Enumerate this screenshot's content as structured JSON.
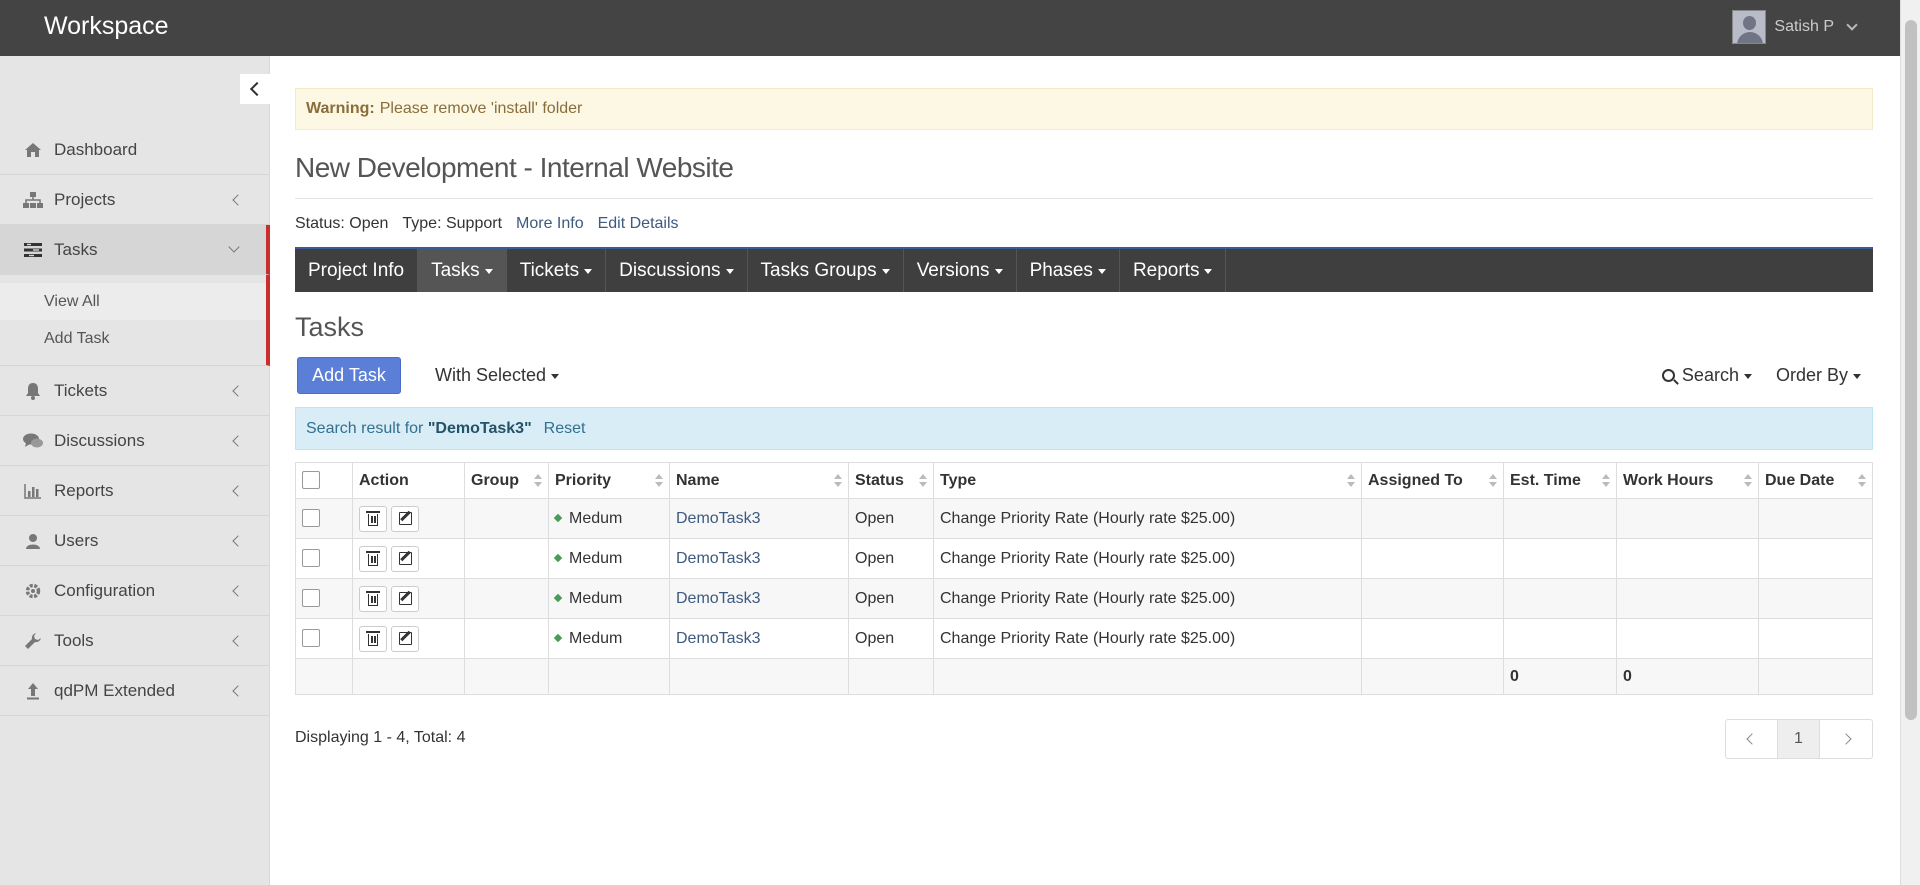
{
  "header": {
    "brand": "Workspace",
    "user_name": "Satish P"
  },
  "sidebar": {
    "items": [
      {
        "label": "Dashboard",
        "icon": "home-icon"
      },
      {
        "label": "Projects",
        "icon": "sitemap-icon"
      },
      {
        "label": "Tasks",
        "icon": "tasks-icon"
      },
      {
        "label": "Tickets",
        "icon": "bell-icon"
      },
      {
        "label": "Discussions",
        "icon": "comments-icon"
      },
      {
        "label": "Reports",
        "icon": "bar-chart-icon"
      },
      {
        "label": "Users",
        "icon": "user-icon"
      },
      {
        "label": "Configuration",
        "icon": "gear-icon"
      },
      {
        "label": "Tools",
        "icon": "wrench-icon"
      },
      {
        "label": "qdPM Extended",
        "icon": "upload-icon"
      }
    ],
    "tasks_sub": [
      {
        "label": "View All"
      },
      {
        "label": "Add Task"
      }
    ]
  },
  "warning": {
    "label": "Warning:",
    "text": "Please remove 'install' folder"
  },
  "project": {
    "title": "New Development - Internal Website",
    "status": "Status: Open",
    "type": "Type: Support",
    "more_info": "More Info",
    "edit_details": "Edit Details"
  },
  "tabs": [
    {
      "label": "Project Info"
    },
    {
      "label": "Tasks"
    },
    {
      "label": "Tickets"
    },
    {
      "label": "Discussions"
    },
    {
      "label": "Tasks Groups"
    },
    {
      "label": "Versions"
    },
    {
      "label": "Phases"
    },
    {
      "label": "Reports"
    }
  ],
  "section": {
    "title": "Tasks"
  },
  "toolbar": {
    "add_task": "Add Task",
    "with_selected": "With Selected",
    "search": "Search",
    "order_by": "Order By"
  },
  "search_result": {
    "prefix": "Search result for",
    "query": "\"DemoTask3\"",
    "reset": "Reset"
  },
  "table": {
    "columns": [
      "Action",
      "Group",
      "Priority",
      "Name",
      "Status",
      "Type",
      "Assigned To",
      "Est. Time",
      "Work Hours",
      "Due Date"
    ],
    "rows": [
      {
        "group": "",
        "priority": "Medum",
        "name": "DemoTask3",
        "status": "Open",
        "type": "Change Priority Rate (Hourly rate $25.00)",
        "assigned": "",
        "est": "",
        "hours": "",
        "due": ""
      },
      {
        "group": "",
        "priority": "Medum",
        "name": "DemoTask3",
        "status": "Open",
        "type": "Change Priority Rate (Hourly rate $25.00)",
        "assigned": "",
        "est": "",
        "hours": "",
        "due": ""
      },
      {
        "group": "",
        "priority": "Medum",
        "name": "DemoTask3",
        "status": "Open",
        "type": "Change Priority Rate (Hourly rate $25.00)",
        "assigned": "",
        "est": "",
        "hours": "",
        "due": ""
      },
      {
        "group": "",
        "priority": "Medum",
        "name": "DemoTask3",
        "status": "Open",
        "type": "Change Priority Rate (Hourly rate $25.00)",
        "assigned": "",
        "est": "",
        "hours": "",
        "due": ""
      }
    ],
    "totals": {
      "est": "0",
      "hours": "0"
    }
  },
  "pagination": {
    "displaying": "Displaying 1 - 4, Total: 4",
    "current_page": "1"
  }
}
